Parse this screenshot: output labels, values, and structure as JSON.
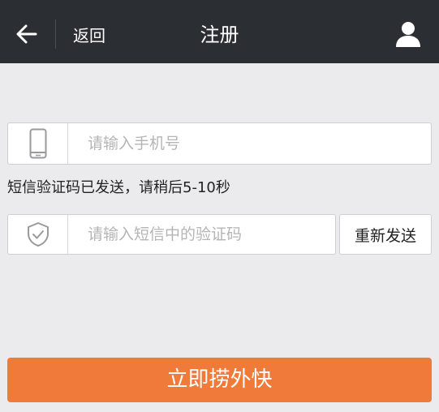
{
  "header": {
    "back_label": "返回",
    "title": "注册",
    "icons": {
      "back": "arrow-left-icon",
      "user": "user-icon"
    }
  },
  "phone": {
    "placeholder": "请输入手机号",
    "value": "",
    "icon": "phone-icon"
  },
  "notice": "短信验证码已发送，请稍后5-10秒",
  "code": {
    "placeholder": "请输入短信中的验证码",
    "value": "",
    "icon": "shield-check-icon"
  },
  "resend_label": "重新发送",
  "submit_label": "立即捞外快",
  "colors": {
    "header_bg": "#2b2f33",
    "page_bg": "#ebebed",
    "accent": "#f07a3a"
  }
}
